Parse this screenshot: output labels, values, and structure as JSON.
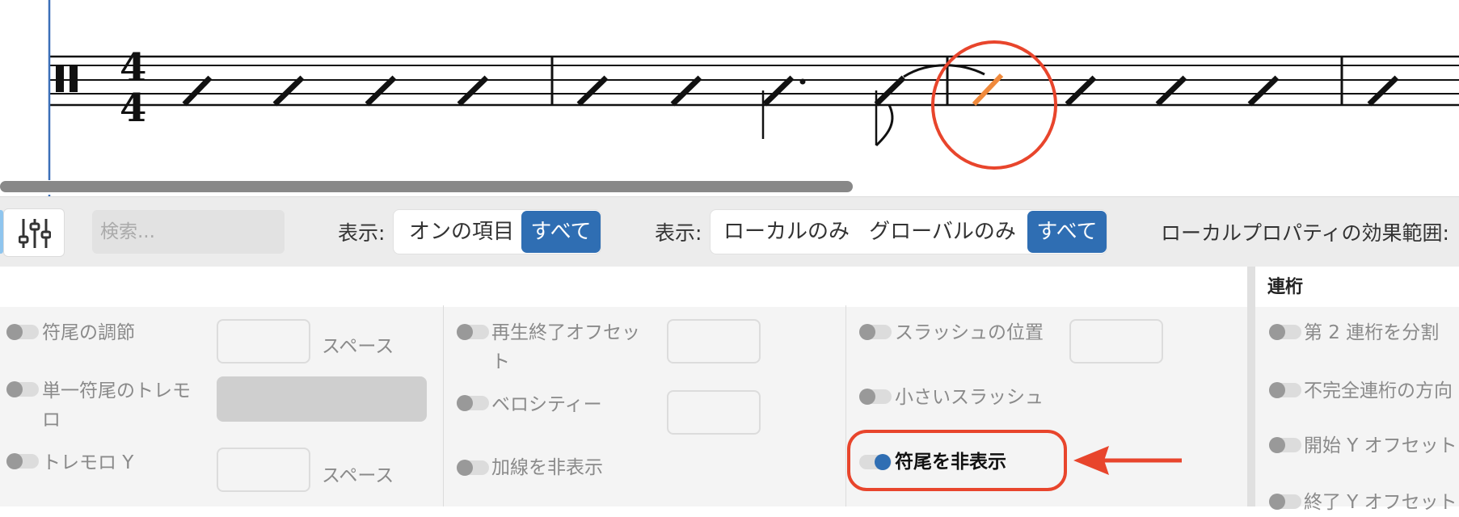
{
  "toolbar": {
    "search_placeholder": "検索...",
    "show_label_1": "表示:",
    "filter1": {
      "on_items": "オンの項目",
      "all": "すべて"
    },
    "show_label_2": "表示:",
    "filter2": {
      "local_only": "ローカルのみ",
      "global_only": "グローバルのみ",
      "all": "すべて"
    },
    "local_scope_label": "ローカルプロパティの効果範囲:"
  },
  "panel": {
    "col1": {
      "stem_adjust": "符尾の調節",
      "stem_adjust_unit": "スペース",
      "single_stem_tremolo": "単一符尾のトレモロ",
      "tremolo_y": "トレモロ Y",
      "tremolo_y_unit": "スペース"
    },
    "col2": {
      "playback_end_offset": "再生終了オフセット",
      "velocity": "ベロシティー",
      "hide_ledger": "加線を非表示"
    },
    "col3": {
      "slash_position": "スラッシュの位置",
      "small_slash": "小さいスラッシュ",
      "hide_stem": "符尾を非表示"
    },
    "tuplet": {
      "title": "連桁",
      "split_second_beam": "第 2 連桁を分割",
      "partial_beam_direction": "不完全連桁の方向",
      "start_y_offset": "開始 Y オフセット",
      "end_y_offset": "終了 Y オフセット"
    }
  },
  "colors": {
    "accent": "#2f6eb3",
    "annotation": "#e8452c",
    "selected_note": "#f08a3c"
  }
}
